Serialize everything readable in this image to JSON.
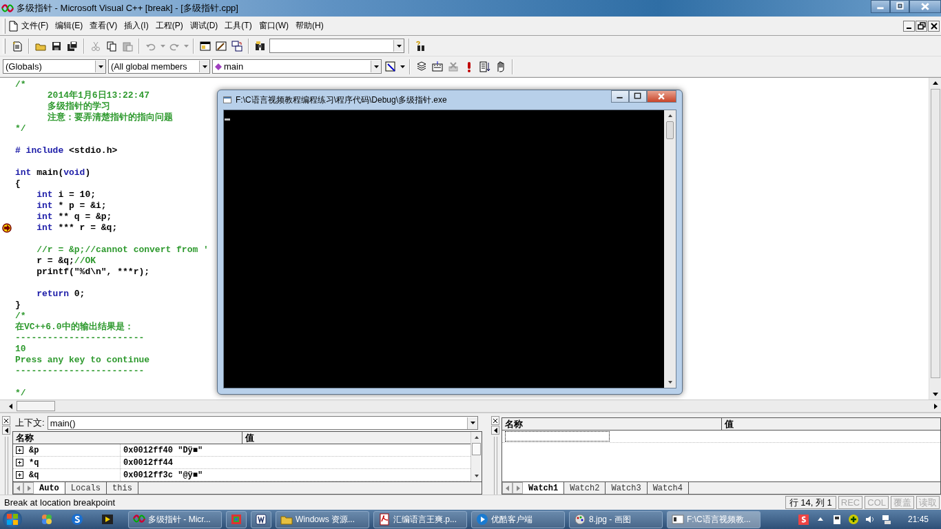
{
  "window": {
    "title": "多级指针 - Microsoft Visual C++ [break] - [多级指针.cpp]"
  },
  "menus": [
    "文件(F)",
    "编辑(E)",
    "查看(V)",
    "插入(I)",
    "工程(P)",
    "调试(D)",
    "工具(T)",
    "窗口(W)",
    "帮助(H)"
  ],
  "wizard_bar": {
    "scope": "(Globals)",
    "members": "(All global members",
    "function": "main"
  },
  "editor": {
    "lines": [
      {
        "current": false,
        "segments": [
          {
            "kind": "comment",
            "text": "/*"
          }
        ]
      },
      {
        "current": false,
        "segments": [
          {
            "kind": "comment",
            "text": "      2014年1月6日13:22:47"
          }
        ]
      },
      {
        "current": false,
        "segments": [
          {
            "kind": "comment",
            "text": "      多级指针的学习"
          }
        ]
      },
      {
        "current": false,
        "segments": [
          {
            "kind": "comment",
            "text": "      注意：要弄清楚指针的指向问题"
          }
        ]
      },
      {
        "current": false,
        "segments": [
          {
            "kind": "comment",
            "text": "*/"
          }
        ]
      },
      {
        "current": false,
        "blank_before": true,
        "segments": [
          {
            "kind": "keyword",
            "text": "# include"
          },
          {
            "kind": "plain",
            "text": " <stdio.h>"
          }
        ]
      },
      {
        "current": false,
        "blank_before": true,
        "segments": [
          {
            "kind": "keyword",
            "text": "int"
          },
          {
            "kind": "plain",
            "text": " main("
          },
          {
            "kind": "keyword",
            "text": "void"
          },
          {
            "kind": "plain",
            "text": ")"
          }
        ]
      },
      {
        "current": false,
        "segments": [
          {
            "kind": "plain",
            "text": "{"
          }
        ]
      },
      {
        "current": false,
        "segments": [
          {
            "kind": "keyword",
            "text": "    int"
          },
          {
            "kind": "plain",
            "text": " i = 10;"
          }
        ]
      },
      {
        "current": false,
        "segments": [
          {
            "kind": "keyword",
            "text": "    int"
          },
          {
            "kind": "plain",
            "text": " * p = &i;"
          }
        ]
      },
      {
        "current": false,
        "segments": [
          {
            "kind": "keyword",
            "text": "    int"
          },
          {
            "kind": "plain",
            "text": " ** q = &p;"
          }
        ]
      },
      {
        "current": true,
        "segments": [
          {
            "kind": "keyword",
            "text": "    int"
          },
          {
            "kind": "plain",
            "text": " *** r = &q;"
          }
        ]
      },
      {
        "current": false,
        "blank_before": true,
        "segments": [
          {
            "kind": "comment",
            "text": "    //r = &p;//cannot convert from '"
          }
        ]
      },
      {
        "current": false,
        "segments": [
          {
            "kind": "plain",
            "text": "    r = &q;"
          },
          {
            "kind": "comment",
            "text": "//OK"
          }
        ]
      },
      {
        "current": false,
        "segments": [
          {
            "kind": "plain",
            "text": "    printf(\"%d\\n\", ***r);"
          }
        ]
      },
      {
        "current": false,
        "blank_before": true,
        "segments": [
          {
            "kind": "keyword",
            "text": "    return"
          },
          {
            "kind": "plain",
            "text": " 0;"
          }
        ]
      },
      {
        "current": false,
        "segments": [
          {
            "kind": "plain",
            "text": "}"
          }
        ]
      },
      {
        "current": false,
        "segments": [
          {
            "kind": "comment",
            "text": "/*"
          }
        ]
      },
      {
        "current": false,
        "segments": [
          {
            "kind": "comment",
            "text": "在VC++6.0中的输出结果是："
          }
        ]
      },
      {
        "current": false,
        "segments": [
          {
            "kind": "comment",
            "text": "------------------------"
          }
        ]
      },
      {
        "current": false,
        "segments": [
          {
            "kind": "comment",
            "text": "10"
          }
        ]
      },
      {
        "current": false,
        "segments": [
          {
            "kind": "comment",
            "text": "Press any key to continue"
          }
        ]
      },
      {
        "current": false,
        "segments": [
          {
            "kind": "comment",
            "text": "------------------------"
          }
        ]
      },
      {
        "current": false,
        "blank_before": true,
        "segments": [
          {
            "kind": "comment",
            "text": "*/"
          }
        ]
      }
    ]
  },
  "console": {
    "title": "F:\\C语言视频教程编程练习\\程序代码\\Debug\\多级指针.exe"
  },
  "variables": {
    "context_label": "上下文:",
    "context_value": "main()",
    "columns": [
      "名称",
      "值"
    ],
    "rows": [
      {
        "name": "&p",
        "value": "0x0012ff40 \"Dÿ■\""
      },
      {
        "name": "*q",
        "value": "0x0012ff44"
      },
      {
        "name": "&q",
        "value": "0x0012ff3c \"@ÿ■\""
      }
    ],
    "tabs": [
      {
        "label": "Auto",
        "selected": true
      },
      {
        "label": "Locals",
        "selected": false
      },
      {
        "label": "this",
        "selected": false
      }
    ]
  },
  "watch": {
    "columns": [
      "名称",
      "值"
    ],
    "tabs": [
      {
        "label": "Watch1",
        "selected": true
      },
      {
        "label": "Watch2",
        "selected": false
      },
      {
        "label": "Watch3",
        "selected": false
      },
      {
        "label": "Watch4",
        "selected": false
      }
    ]
  },
  "status_bar": {
    "message": "Break at location breakpoint",
    "position": "行 14, 列 1",
    "indicators": [
      {
        "label": "REC",
        "disabled": true
      },
      {
        "label": "COL",
        "disabled": true
      },
      {
        "label": "覆盖",
        "disabled": true
      },
      {
        "label": "读取",
        "disabled": true
      }
    ]
  },
  "taskbar": {
    "tasks": [
      {
        "label": "多级指针 - Micr...",
        "selected": false
      },
      {
        "selected": false
      },
      {
        "selected": false
      },
      {
        "label": "Windows 资源...",
        "selected": false
      },
      {
        "label": "汇编语言王爽.p...",
        "selected": false
      },
      {
        "label": "优酷客户端",
        "selected": false
      },
      {
        "label": "8.jpg - 画图",
        "selected": false
      },
      {
        "label": "F:\\C语言视频教...",
        "selected": true
      }
    ],
    "clock": "21:45"
  }
}
